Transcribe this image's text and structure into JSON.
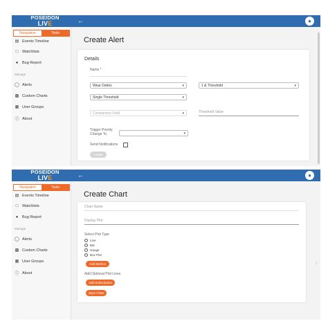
{
  "brand": {
    "line1": "POSEIDON",
    "line2a": "LIV",
    "line2b": "E"
  },
  "nav_tabs": {
    "navigation": "Navigation",
    "tools": "Tools"
  },
  "sidebar": {
    "items": [
      "Events Timeline",
      "Watchlists",
      "Bug Report"
    ],
    "section_label": "Manage",
    "manage_items": [
      "Alerts",
      "Custom Charts",
      "User Groups",
      "About"
    ]
  },
  "alert_form": {
    "title": "Create Alert",
    "section": "Details",
    "name_label": "Name *",
    "select1": "Wear Debris",
    "select2": "1 & Threshold",
    "select3": "Single Threshold",
    "comparison_placeholder": "Comparison Field",
    "threshold_placeholder": "Threshold Value",
    "trigger_label": "Trigger Priority Change To",
    "send_label": "Send Notifications",
    "create_btn": "Create"
  },
  "chart_form": {
    "title": "Create Chart",
    "chart_name_placeholder": "Chart Name",
    "display_placeholder": "Display Plot",
    "plot_type_label": "Select Plot Type",
    "plot_types": [
      "Line",
      "Bar",
      "Gauge",
      "Box Plot"
    ],
    "add_metric_btn": "Add Metrics",
    "optional_label": "Add Optional Plot Lines",
    "add_subs_btn": "Add Subscription",
    "save_btn": "Save Chart"
  },
  "colors": {
    "topbar": "#2f6db0",
    "accent": "#ee6a2a"
  }
}
